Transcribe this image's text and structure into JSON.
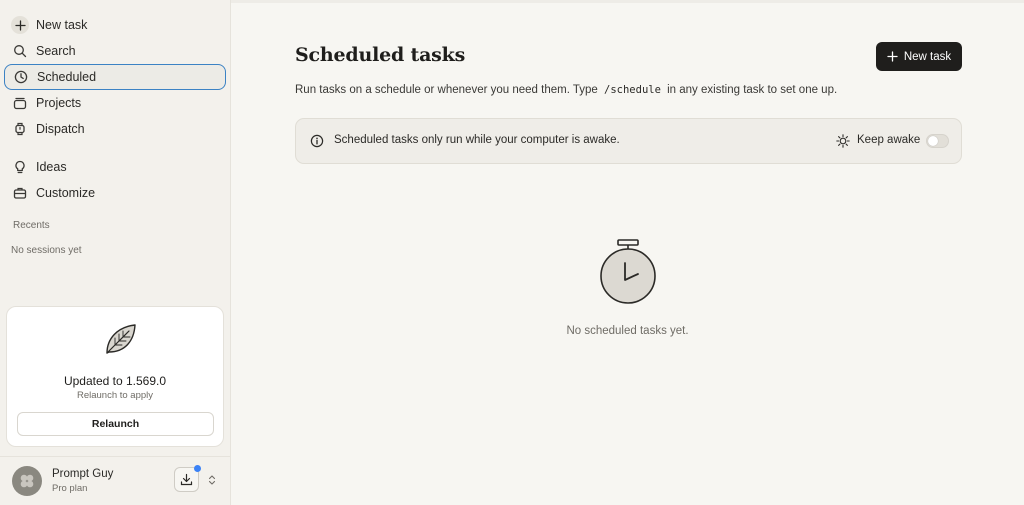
{
  "sidebar": {
    "nav": [
      {
        "label": "New task",
        "icon": "plus-icon"
      },
      {
        "label": "Search",
        "icon": "search-icon"
      },
      {
        "label": "Scheduled",
        "icon": "clock-icon",
        "active": true
      },
      {
        "label": "Projects",
        "icon": "folder-stack-icon"
      },
      {
        "label": "Dispatch",
        "icon": "watch-icon"
      },
      {
        "label": "Ideas",
        "icon": "lightbulb-icon"
      },
      {
        "label": "Customize",
        "icon": "briefcase-icon"
      }
    ],
    "recents_label": "Recents",
    "no_sessions": "No sessions yet",
    "update_card": {
      "icon": "leaf-icon",
      "title": "Updated to 1.569.0",
      "subtitle": "Relaunch to apply",
      "button": "Relaunch"
    },
    "profile": {
      "name": "Prompt Guy",
      "plan": "Pro plan",
      "download_icon": "download-icon",
      "has_notification": true,
      "notification_color": "#3b82f6"
    }
  },
  "main": {
    "title": "Scheduled tasks",
    "new_task_button": "New task",
    "description_before": "Run tasks on a schedule or whenever you need them. Type",
    "description_code": "/schedule",
    "description_after": "in any existing task to set one up.",
    "banner": {
      "message": "Scheduled tasks only run while your computer is awake.",
      "keep_awake_label": "Keep awake",
      "keep_awake_on": false
    },
    "empty_state": {
      "icon": "stopwatch-icon",
      "text": "No scheduled tasks yet."
    }
  },
  "colors": {
    "accent_focus": "#3b82c4",
    "primary_button": "#1f1e1c",
    "background": "#f7f6f2"
  }
}
